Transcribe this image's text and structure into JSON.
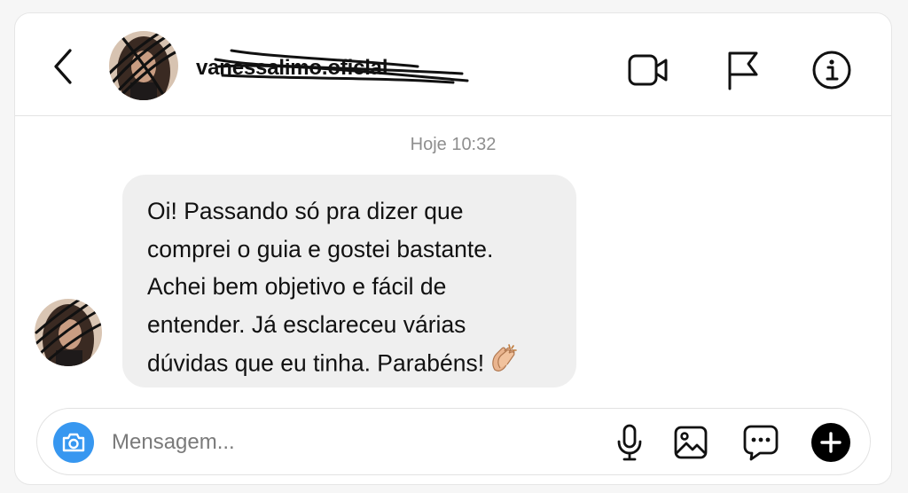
{
  "header": {
    "username": "vanessalimo.oficial",
    "icons": {
      "back": "chevron-left-icon",
      "video": "video-call-icon",
      "report": "flag-icon",
      "info": "info-icon"
    }
  },
  "thread": {
    "timestamp": "Hoje 10:32",
    "messages": [
      {
        "lines": [
          "Oi! Passando só pra dizer que",
          "comprei o guia e gostei bastante.",
          "Achei bem objetivo e fácil de",
          "entender. Já esclareceu várias",
          "dúvidas que eu tinha. Parabéns!"
        ],
        "emoji": "clapping-hands-emoji"
      }
    ]
  },
  "composer": {
    "placeholder": "Mensagem...",
    "value": "",
    "icons": {
      "camera": "camera-icon",
      "mic": "microphone-icon",
      "gallery": "image-icon",
      "sticker": "chat-bubble-icon",
      "add": "plus-circle-icon"
    }
  },
  "colors": {
    "accent": "#3797f0",
    "bubble": "#efefef",
    "text": "#111111",
    "muted": "#8e8e8e"
  }
}
